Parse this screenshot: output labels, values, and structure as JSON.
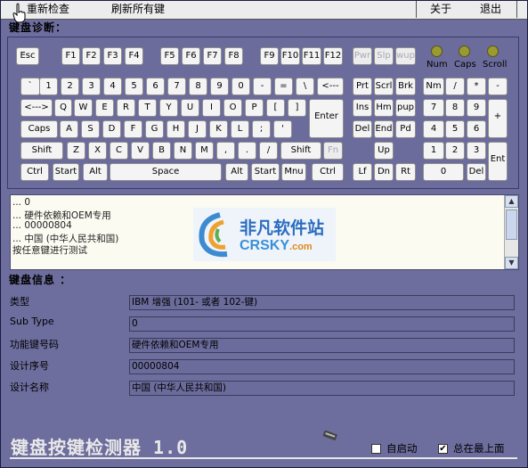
{
  "toolbar": {
    "recheck": "重新检查",
    "refresh_all": "刷新所有键",
    "about": "关于",
    "exit": "退出"
  },
  "keyboard": {
    "section_title": "键盘诊断：",
    "leds": [
      "Num",
      "Caps",
      "Scroll"
    ],
    "led_color": "#9a9a30",
    "rows": {
      "fn_row": [
        "Esc",
        "F1",
        "F2",
        "F3",
        "F4",
        "F5",
        "F6",
        "F7",
        "F8",
        "F9",
        "F10",
        "F11",
        "F12",
        "Pwr",
        "Slp",
        "wup"
      ],
      "num_row": [
        "`",
        "1",
        "2",
        "3",
        "4",
        "5",
        "6",
        "7",
        "8",
        "9",
        "0",
        "-",
        "=",
        "\\",
        "<---"
      ],
      "q_row": [
        "<--->",
        "Q",
        "W",
        "E",
        "R",
        "T",
        "Y",
        "U",
        "I",
        "O",
        "P",
        "[",
        "]",
        "Enter"
      ],
      "a_row": [
        "Caps",
        "A",
        "S",
        "D",
        "F",
        "G",
        "H",
        "J",
        "K",
        "L",
        ";",
        "'"
      ],
      "z_row": [
        "Shift",
        "Z",
        "X",
        "C",
        "V",
        "B",
        "N",
        "M",
        ",",
        ".",
        "/",
        "Shift",
        "Fn"
      ],
      "bottom_row": [
        "Ctrl",
        "Start",
        "Alt",
        "Space",
        "Alt",
        "Start",
        "Mnu",
        "Ctrl"
      ],
      "nav": [
        "Prt",
        "Scrl",
        "Brk",
        "Ins",
        "Hm",
        "pup",
        "Del",
        "End",
        "Pd",
        "Up",
        "Lf",
        "Dn",
        "Rt"
      ],
      "numpad": [
        "Nm",
        "/",
        "*",
        "-",
        "7",
        "8",
        "9",
        "+",
        "4",
        "5",
        "6",
        "1",
        "2",
        "3",
        "Ent",
        "0",
        "Del"
      ]
    }
  },
  "log": {
    "lines": [
      "... 0",
      "... 硬件依赖和OEM专用",
      "... 00000804",
      "... 中国 (中华人民共和国)",
      "按任意键进行测试"
    ]
  },
  "watermark": {
    "cn": "非凡软件站",
    "en_a": "CRSKY",
    "en_b": ".com"
  },
  "info": {
    "section_title": "键盘信息 ：",
    "type_label": "类型",
    "type_value": "IBM 增强 (101- 或者 102-键)",
    "subtype_label": "Sub Type",
    "subtype_value": "0",
    "funckey_label": "功能键号码",
    "funckey_value": "硬件依赖和OEM专用",
    "serial_label": "设计序号",
    "serial_value": "00000804",
    "name_label": "设计名称",
    "name_value": "中国 (中华人民共和国)"
  },
  "footer": {
    "app_title": "键盘按键检测器 1.0",
    "autostart_label": "自启动",
    "autostart_checked": false,
    "ontop_label": "总在最上面",
    "ontop_checked": true,
    "check_mark": "✔"
  },
  "colors": {
    "window_bg": "#6d6d9e",
    "key_bg": "#f4f4f4",
    "field_bg": "#6b6b9c"
  }
}
